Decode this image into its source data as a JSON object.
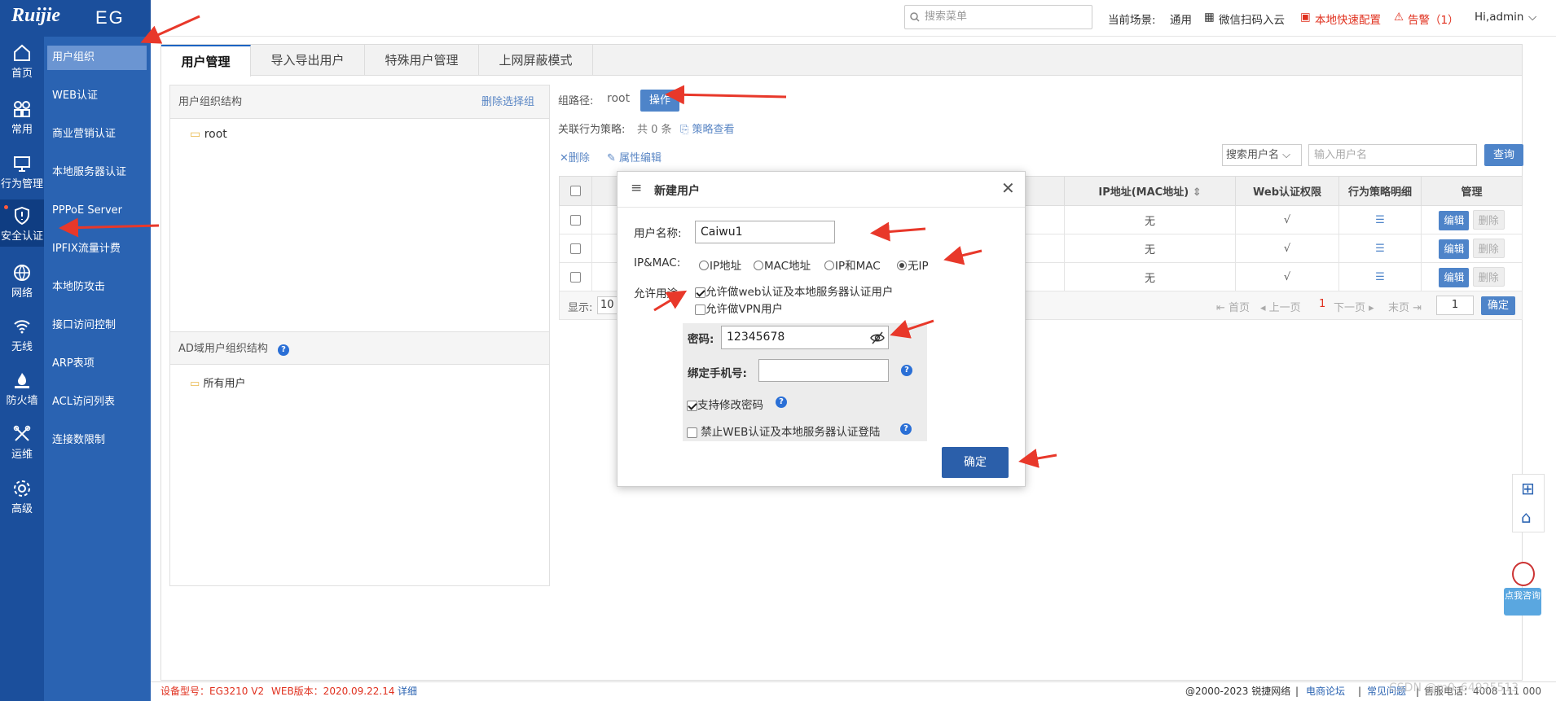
{
  "brand": {
    "logo": "Ruijie",
    "product": "EG"
  },
  "rail": [
    {
      "label": "首页",
      "icon": "home-icon"
    },
    {
      "label": "常用",
      "icon": "grid-icon"
    },
    {
      "label": "行为管理",
      "icon": "monitor-icon"
    },
    {
      "label": "安全认证",
      "icon": "shield-icon"
    },
    {
      "label": "网络",
      "icon": "globe-icon"
    },
    {
      "label": "无线",
      "icon": "wifi-icon"
    },
    {
      "label": "防火墙",
      "icon": "firewall-icon"
    },
    {
      "label": "运维",
      "icon": "tools-icon"
    },
    {
      "label": "高级",
      "icon": "gear-icon"
    }
  ],
  "submenu": [
    "用户组织",
    "WEB认证",
    "商业营销认证",
    "本地服务器认证",
    "PPPoE Server",
    "IPFIX流量计费",
    "本地防攻击",
    "接口访问控制",
    "ARP表项",
    "ACL访问列表",
    "连接数限制"
  ],
  "header": {
    "search_placeholder": "搜索菜单",
    "scene_label": "当前场景:",
    "scene_value": "通用",
    "wechat": "微信扫码入云",
    "quick": "本地快速配置",
    "alarm": "告警（1）",
    "user": "Hi,admin"
  },
  "tabs": [
    "用户管理",
    "导入导出用户",
    "特殊用户管理",
    "上网屏蔽模式"
  ],
  "left_panel": {
    "title": "用户组织结构",
    "delete_link": "删除选择组",
    "root": "root",
    "ad_title": "AD域用户组织结构",
    "all_users": "所有用户"
  },
  "right": {
    "path_label": "组路径:",
    "path_value": "root",
    "op_button": "操作",
    "policy_label": "关联行为策略:",
    "policy_count": "共 0 条",
    "policy_view": "策略查看",
    "delete": "删除",
    "attr_edit": "属性编辑",
    "search_select": "搜索用户名",
    "search_placeholder": "输入用户名",
    "query": "查询",
    "columns": [
      "IP地址(MAC地址)",
      "Web认证权限",
      "行为策略明细",
      "管理"
    ],
    "rows": [
      {
        "ip": "无",
        "web": "√"
      },
      {
        "ip": "无",
        "web": "√"
      },
      {
        "ip": "无",
        "web": "√"
      }
    ],
    "edit": "编辑",
    "del": "删除",
    "display_label": "显示:",
    "page_size": "10",
    "pager": {
      "first": "首页",
      "prev": "上一页",
      "current": "1",
      "next": "下一页",
      "last": "末页",
      "page_input": "1",
      "confirm": "确定"
    }
  },
  "dialog": {
    "title": "新建用户",
    "username_label": "用户名称:",
    "username_value": "Caiwu1",
    "ipmac_label": "IP&MAC:",
    "ipmac_options": [
      "IP地址",
      "MAC地址",
      "IP和MAC",
      "无IP"
    ],
    "ipmac_selected": 3,
    "usage_label": "允许用途:",
    "usage_web": "允许做web认证及本地服务器认证用户",
    "usage_vpn": "允许做VPN用户",
    "password_label": "密码:",
    "password_value": "12345678",
    "phone_label": "绑定手机号:",
    "modify_pwd": "支持修改密码",
    "forbid_web": "禁止WEB认证及本地服务器认证登陆",
    "confirm": "确定"
  },
  "footer": {
    "model": "设备型号：EG3210 V2",
    "web_version": "WEB版本：2020.09.22.14",
    "detail": "详细",
    "copyright": "@2000-2023 锐捷网络",
    "forum": "电商论坛",
    "faq": "常见问题",
    "hotline": "售服电话：4008 111 000",
    "watermark": "CSDN @m0_64925513"
  },
  "help_bubble": "点我咨询",
  "colors": {
    "rail": "#1b4f9c",
    "submenu": "#2a63b2",
    "accent": "#4e84c9",
    "alert": "#e0301e"
  }
}
